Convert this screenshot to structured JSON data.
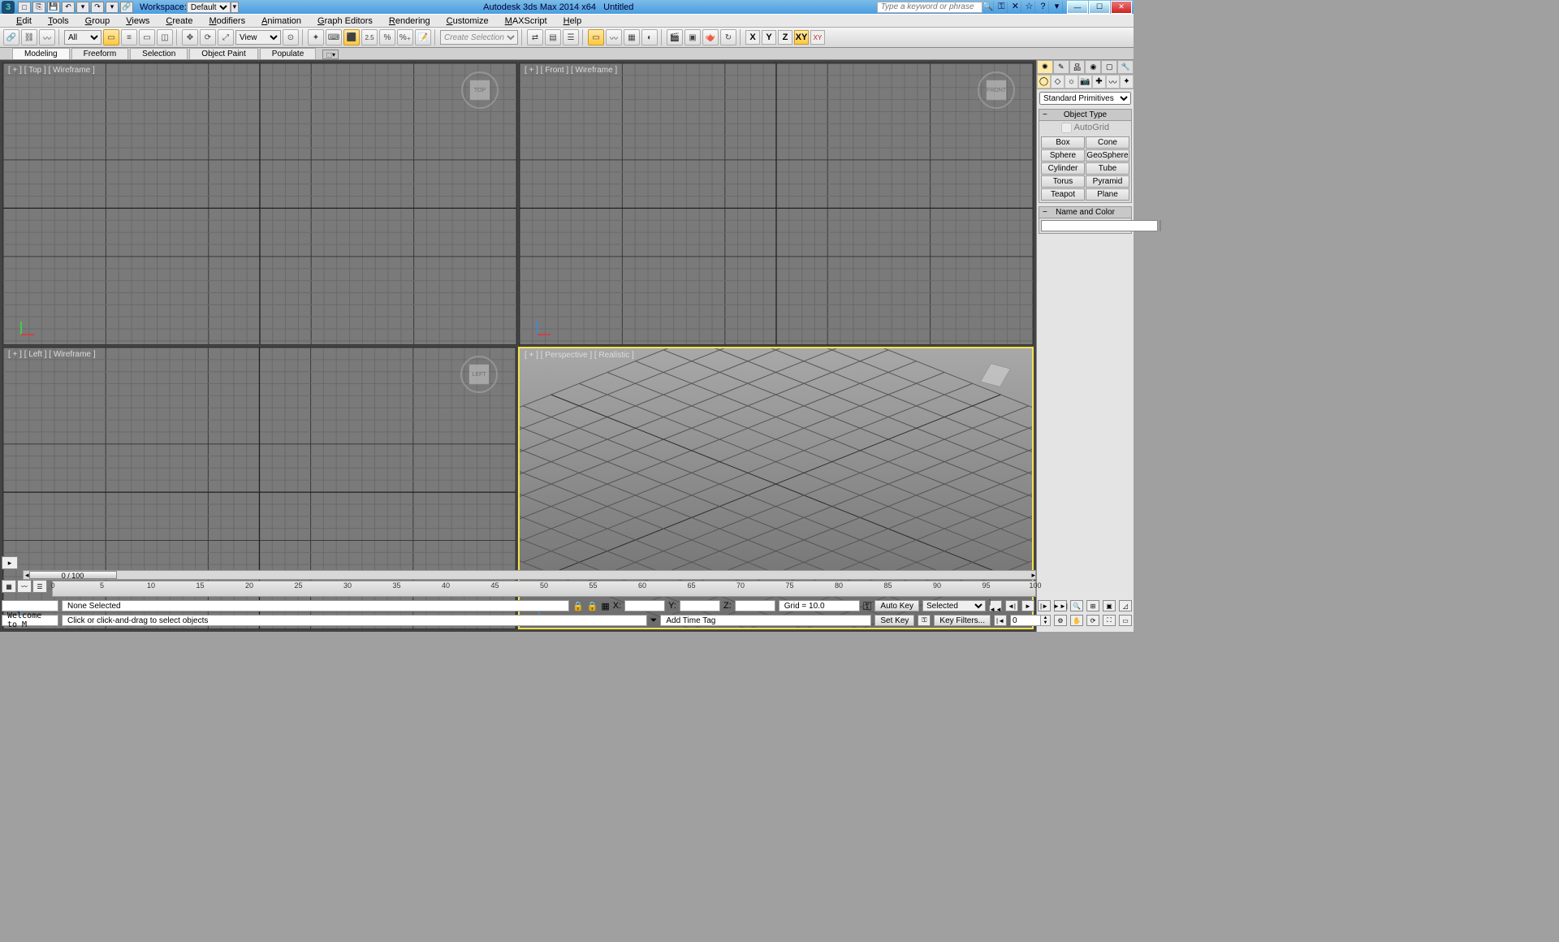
{
  "title": {
    "app": "Autodesk 3ds Max 2014 x64",
    "doc": "Untitled",
    "workspace_label": "Workspace:",
    "workspace_value": "Default",
    "search_placeholder": "Type a keyword or phrase"
  },
  "menu": [
    "Edit",
    "Tools",
    "Group",
    "Views",
    "Create",
    "Modifiers",
    "Animation",
    "Graph Editors",
    "Rendering",
    "Customize",
    "MAXScript",
    "Help"
  ],
  "toolbar": {
    "sel_filter": "All",
    "ref_sys": "View",
    "named_sel_placeholder": "Create Selection Se",
    "axes": [
      "X",
      "Y",
      "Z",
      "XY"
    ],
    "axes_on": 3,
    "xy_red": "XY"
  },
  "ribbon": {
    "tabs": [
      "Modeling",
      "Freeform",
      "Selection",
      "Object Paint",
      "Populate"
    ],
    "active": 0
  },
  "viewports": {
    "tl": "[ + ] [ Top ] [ Wireframe ]",
    "tr": "[ + ] [ Front ] [ Wireframe ]",
    "bl": "[ + ] [ Left ] [ Wireframe ]",
    "br": "[ + ] [ Perspective ] [ Realistic ]",
    "cube_top": "TOP",
    "cube_front": "FRONT",
    "cube_left": "LEFT"
  },
  "cmd": {
    "dropdown": "Standard Primitives",
    "obj_type": "Object Type",
    "autogrid": "AutoGrid",
    "buttons": [
      "Box",
      "Cone",
      "Sphere",
      "GeoSphere",
      "Cylinder",
      "Tube",
      "Torus",
      "Pyramid",
      "Teapot",
      "Plane"
    ],
    "name_color": "Name and Color"
  },
  "timeline": {
    "thumb": "0 / 100",
    "ticks": [
      0,
      5,
      10,
      15,
      20,
      25,
      30,
      35,
      40,
      45,
      50,
      55,
      60,
      65,
      70,
      75,
      80,
      85,
      90,
      95,
      100
    ]
  },
  "status": {
    "sel": "None Selected",
    "welcome": "Welcome to M",
    "prompt": "Click or click-and-drag to select objects",
    "x": "X:",
    "y": "Y:",
    "z": "Z:",
    "grid": "Grid = 10.0",
    "autokey": "Auto Key",
    "setkey": "Set Key",
    "selected": "Selected",
    "keyfilters": "Key Filters...",
    "addtag": "Add Time Tag",
    "frame": "0"
  },
  "icons": {
    "lock": "🔒",
    "grid": "▦",
    "key": "⚿",
    "add": "+",
    "arrow": "►",
    "back": "|◄◄",
    "stepb": "◄|",
    "play": "►",
    "stepf": "|►",
    "end": "►►|"
  }
}
